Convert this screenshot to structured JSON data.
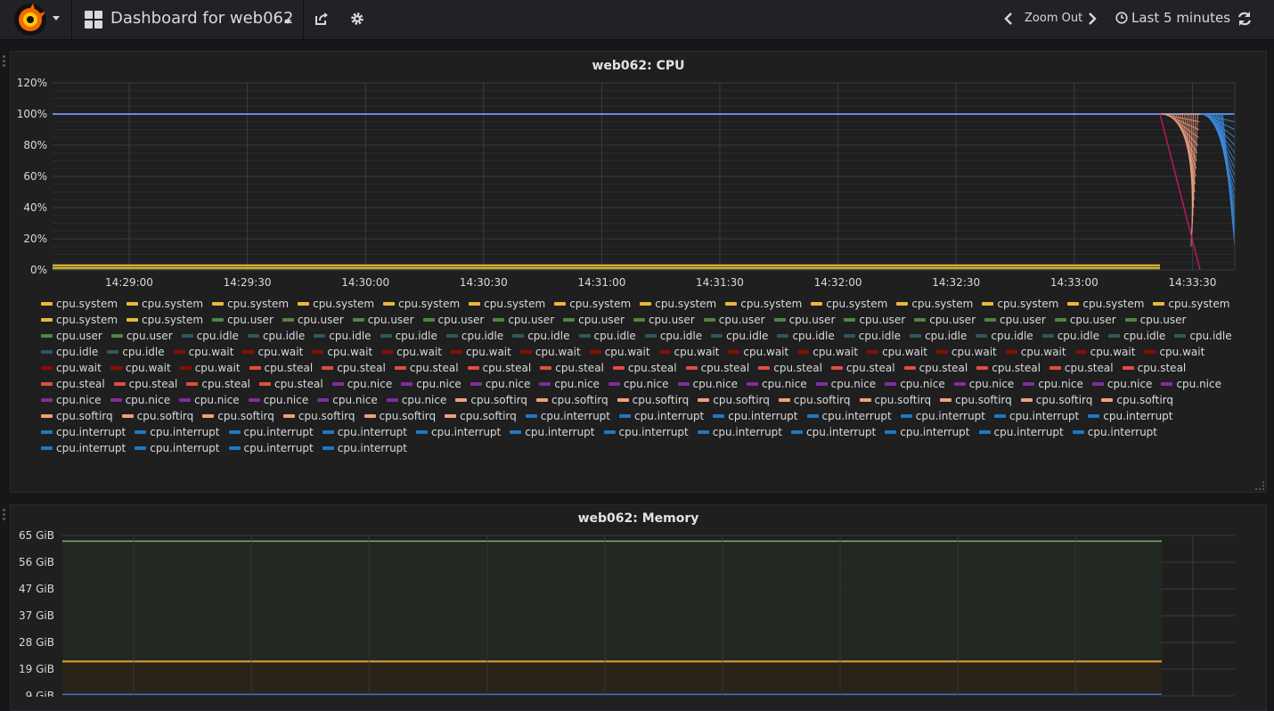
{
  "nav": {
    "dashboard_title": "Dashboard for web062",
    "zoom_out_label": "Zoom Out",
    "time_range_label": "Last 5 minutes"
  },
  "icons": {
    "logo": "grafana-logo-icon",
    "dashboards": "grid-icon",
    "share": "share-icon",
    "settings": "gear-icon",
    "time": "clock-icon",
    "refresh": "refresh-icon"
  },
  "colors": {
    "cpu.system": "#eab839",
    "cpu.user": "#508642",
    "cpu.idle": "#2f575e",
    "cpu.wait": "#890f02",
    "cpu.steal": "#e24d42",
    "cpu.nice": "#7e2e9e",
    "cpu.softirq": "#ef9f7f",
    "cpu.interrupt": "#1f78c1",
    "memory_top": "#7eb26d",
    "memory_mid": "#e5a232",
    "memory_low": "#4874b8"
  },
  "panels": {
    "cpu": {
      "title": "web062: CPU",
      "chart_data": {
        "type": "line",
        "yticks": [
          "0%",
          "20%",
          "40%",
          "60%",
          "80%",
          "100%",
          "120%"
        ],
        "ylim": [
          0,
          120
        ],
        "xticks": [
          "14:29:00",
          "14:29:30",
          "14:30:00",
          "14:30:30",
          "14:31:00",
          "14:31:30",
          "14:32:00",
          "14:32:30",
          "14:33:00",
          "14:33:30"
        ],
        "grid": true,
        "legend": "bottom",
        "legend_entries": [
          {
            "name": "cpu.system",
            "count": 16
          },
          {
            "name": "cpu.user",
            "count": 16
          },
          {
            "name": "cpu.idle",
            "count": 18
          },
          {
            "name": "cpu.wait",
            "count": 18
          },
          {
            "name": "cpu.steal",
            "count": 17
          },
          {
            "name": "cpu.nice",
            "count": 19
          },
          {
            "name": "cpu.softirq",
            "count": 15
          },
          {
            "name": "cpu.interrupt",
            "count": 23
          }
        ],
        "series": [
          {
            "name": "cpu.idle",
            "values": [
              100,
              100,
              100,
              100,
              100,
              100,
              100,
              100,
              100,
              100
            ]
          },
          {
            "name": "cpu.system",
            "values": [
              3,
              3,
              3,
              3,
              3,
              3,
              3,
              3,
              3,
              3
            ]
          }
        ]
      }
    },
    "memory": {
      "title": "web062: Memory",
      "chart_data": {
        "type": "area",
        "yticks": [
          "9 GiB",
          "19 GiB",
          "28 GiB",
          "37 GiB",
          "47 GiB",
          "56 GiB",
          "65 GiB"
        ],
        "ylim": [
          9,
          65
        ],
        "grid": true,
        "series": [
          {
            "values": [
              63,
              63,
              63,
              63,
              63,
              63,
              63,
              63,
              63,
              63
            ]
          },
          {
            "values": [
              21,
              21,
              21,
              21,
              21,
              21,
              21,
              21,
              21,
              21
            ]
          },
          {
            "values": [
              9.5,
              9.5,
              9.5,
              9.5,
              9.5,
              9.5,
              9.5,
              9.5,
              9.5,
              9.5
            ]
          }
        ]
      }
    }
  }
}
